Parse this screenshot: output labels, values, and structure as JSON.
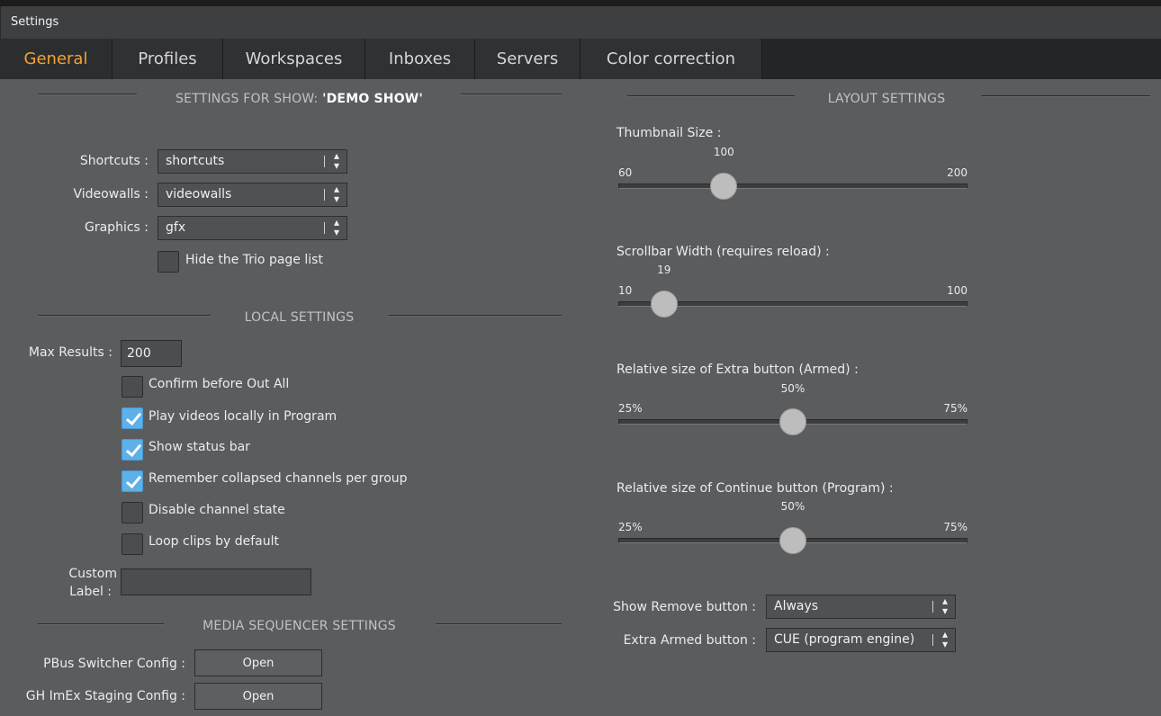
{
  "window": {
    "title": "Settings"
  },
  "tabs": [
    {
      "label": "General"
    },
    {
      "label": "Profiles"
    },
    {
      "label": "Workspaces"
    },
    {
      "label": "Inboxes"
    },
    {
      "label": "Servers"
    },
    {
      "label": "Color correction"
    }
  ],
  "active_tab": "General",
  "accent_color": "#f1a431",
  "show_settings": {
    "heading_prefix": "SETTINGS FOR SHOW: ",
    "show_name": "'DEMO SHOW'",
    "shortcuts": {
      "label": "Shortcuts :",
      "value": "shortcuts"
    },
    "videowalls": {
      "label": "Videowalls :",
      "value": "videowalls"
    },
    "graphics": {
      "label": "Graphics :",
      "value": "gfx"
    },
    "hide_trio": {
      "label": "Hide the Trio page list",
      "checked": false
    }
  },
  "local_settings": {
    "heading": "LOCAL SETTINGS",
    "max_results": {
      "label": "Max Results :",
      "value": "200"
    },
    "options": [
      {
        "label": "Confirm before Out All",
        "checked": false
      },
      {
        "label": "Play videos locally in Program",
        "checked": true
      },
      {
        "label": "Show status bar",
        "checked": true
      },
      {
        "label": "Remember collapsed channels per group",
        "checked": true
      },
      {
        "label": "Disable channel state",
        "checked": false
      },
      {
        "label": "Loop clips by default",
        "checked": false
      }
    ],
    "custom_label": {
      "label_line1": "Custom",
      "label_line2": "Label :",
      "value": ""
    }
  },
  "media_sequencer": {
    "heading": "MEDIA SEQUENCER SETTINGS",
    "pbus": {
      "label": "PBus Switcher Config :",
      "button": "Open"
    },
    "ghimex": {
      "label": "GH ImEx Staging Config :",
      "button": "Open"
    }
  },
  "layout_settings": {
    "heading": "LAYOUT SETTINGS",
    "sliders": [
      {
        "title": "Thumbnail Size :",
        "min": "60",
        "max": "200",
        "value": "100",
        "fraction": 0.2857
      },
      {
        "title": "Scrollbar Width (requires reload) :",
        "min": "10",
        "max": "100",
        "value": "19",
        "fraction": 0.1
      },
      {
        "title": "Relative size of Extra button (Armed) :",
        "min": "25%",
        "max": "75%",
        "value": "50%",
        "fraction": 0.5
      },
      {
        "title": "Relative size of Continue button (Program) :",
        "min": "25%",
        "max": "75%",
        "value": "50%",
        "fraction": 0.5
      }
    ],
    "show_remove": {
      "label": "Show Remove button :",
      "value": "Always"
    },
    "extra_armed": {
      "label": "Extra Armed button :",
      "value": "CUE (program engine)"
    }
  },
  "icons": {
    "select_arrows": "up-down-chevron-icon",
    "check": "checkmark-icon"
  }
}
